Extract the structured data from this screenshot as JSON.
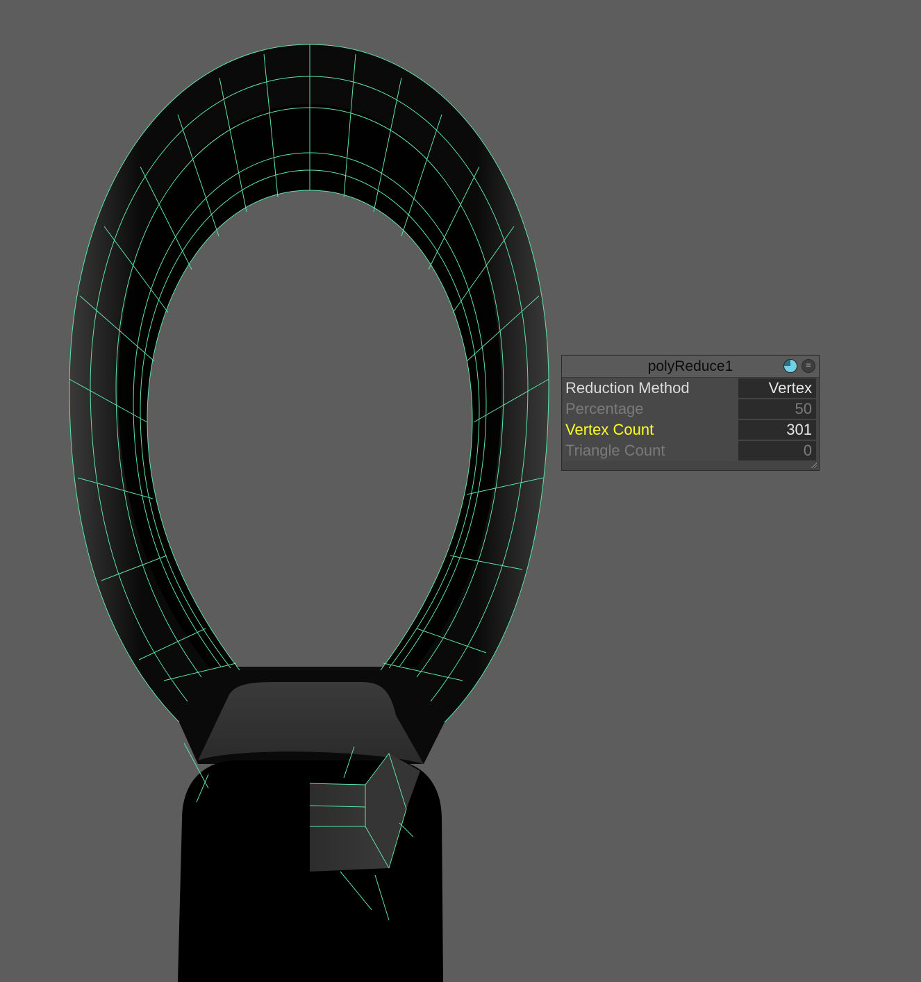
{
  "viewport": {
    "background": "#5d5d5d",
    "wireframe_color": "#5fe3a8",
    "mesh_color": "#000000"
  },
  "hud": {
    "title": "polyReduce1",
    "icons": [
      "pie-chart-icon",
      "menu-icon"
    ],
    "rows": [
      {
        "label": "Reduction Method",
        "value": "Vertex",
        "state": "normal"
      },
      {
        "label": "Percentage",
        "value": "50",
        "state": "disabled"
      },
      {
        "label": "Vertex Count",
        "value": "301",
        "state": "active"
      },
      {
        "label": "Triangle Count",
        "value": "0",
        "state": "disabled"
      }
    ],
    "colors": {
      "active_label": "#ffff24",
      "disabled_label": "#7a7a7a",
      "normal_label": "#dcdcdc"
    }
  }
}
